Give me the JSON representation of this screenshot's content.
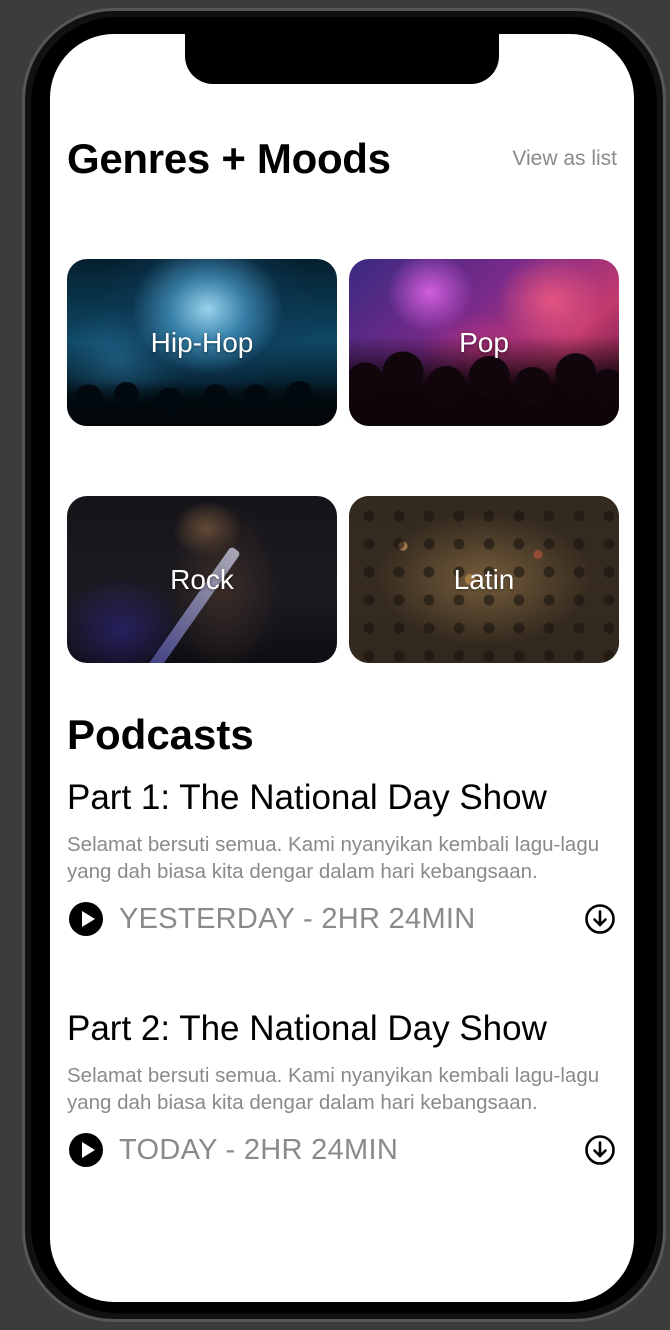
{
  "header": {
    "title": "Genres + Moods",
    "view_as_list": "View as list"
  },
  "genres": [
    {
      "label": "Hip-Hop"
    },
    {
      "label": "Pop"
    },
    {
      "label": "Rock"
    },
    {
      "label": "Latin"
    }
  ],
  "podcasts": {
    "section_title": "Podcasts",
    "episodes": [
      {
        "title": "Part 1: The National Day Show",
        "description": "Selamat bersuti semua. Kami nyanyikan kembali lagu-lagu yang dah biasa kita dengar dalam hari kebangsaan.",
        "meta": "YESTERDAY - 2HR 24MIN",
        "play_icon": "play-circle-icon",
        "download_icon": "download-circle-icon"
      },
      {
        "title": "Part 2: The National Day Show",
        "description": "Selamat bersuti semua. Kami nyanyikan kembali lagu-lagu yang dah biasa kita dengar dalam hari kebangsaan.",
        "meta": "TODAY - 2HR 24MIN",
        "play_icon": "play-circle-icon",
        "download_icon": "download-circle-icon"
      }
    ]
  },
  "colors": {
    "background": "#ffffff",
    "primary_text": "#000000",
    "secondary_text": "#8a8a8e"
  }
}
